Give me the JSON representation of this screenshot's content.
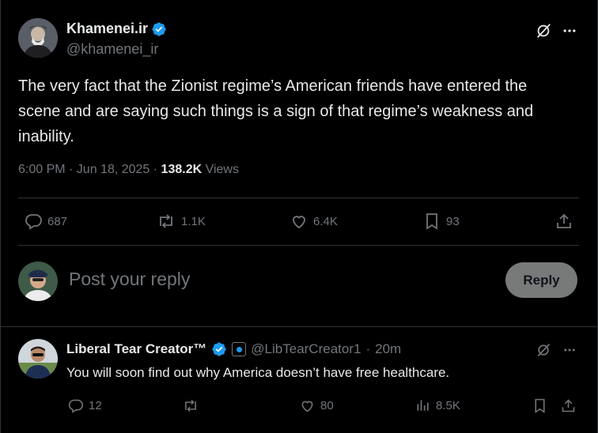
{
  "post": {
    "author_name": "Khamenei.ir",
    "author_handle": "@khamenei_ir",
    "text": "The very fact that the Zionist regime’s American friends have entered the scene and are saying such things is a sign of that regime’s weakness and inability.",
    "time": "6:00 PM · Jun 18, 2025 · ",
    "views_count": "138.2K",
    "views_label": " Views",
    "replies": "687",
    "reposts": "1.1K",
    "likes": "6.4K",
    "bookmarks": "93"
  },
  "composer": {
    "placeholder": "Post your reply",
    "button": "Reply"
  },
  "reply": {
    "author_name": "Liberal Tear Creator™",
    "author_handle": "@LibTearCreator1",
    "separator": "·",
    "time": "20m",
    "text": "You will soon find out why America doesn’t have free healthcare.",
    "replies": "12",
    "likes": "80",
    "views": "8.5K"
  },
  "colors": {
    "background": "#000000",
    "text": "#e7e9ea",
    "muted": "#71767b",
    "divider": "#2f3336",
    "verified": "#1d9bf0",
    "reply_button": "#787a7a"
  }
}
